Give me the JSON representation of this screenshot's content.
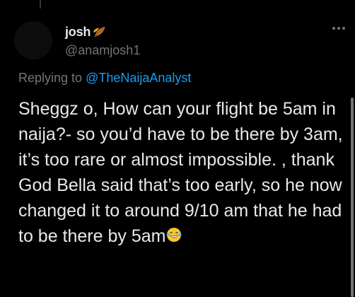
{
  "tweet": {
    "display_name": "josh",
    "handle": "@anamjosh1",
    "replying_prefix": "Replying to ",
    "replying_mention": "@TheNaijaAnalyst",
    "text": "Sheggz o, How can your flight be 5am in naija?- so you’d have to be there by 3am, it’s too rare or almost impossible. , thank God Bella said that’s too early, so he now changed it to around 9/10 am that he had to be there by 5am"
  },
  "icons": {
    "name_emoji": "fallen-leaf-emoji-icon",
    "text_emoji": "face-with-tears-of-joy-emoji-icon",
    "more": "more-options-icon"
  },
  "colors": {
    "background": "#000000",
    "primary_text": "#e7e9ea",
    "secondary_text": "#71767b",
    "link": "#1d9bf0"
  }
}
